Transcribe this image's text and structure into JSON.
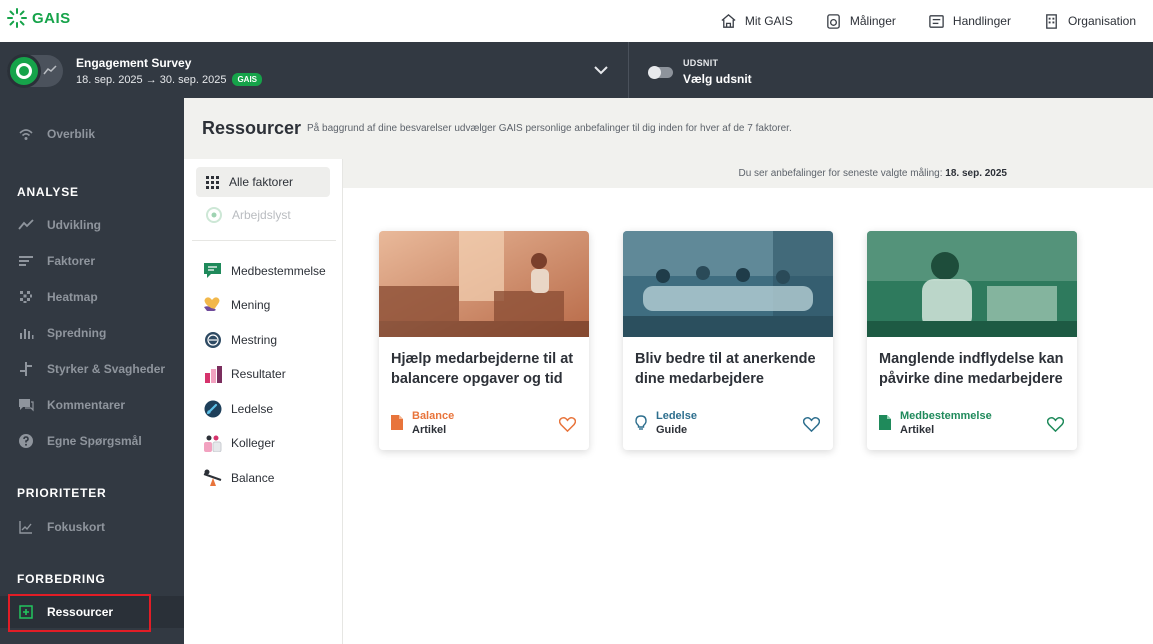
{
  "app": {
    "name": "GAIS"
  },
  "topnav": {
    "links": [
      {
        "label": "Mit GAIS",
        "icon": "home-icon"
      },
      {
        "label": "Målinger",
        "icon": "measure-icon"
      },
      {
        "label": "Handlinger",
        "icon": "actions-icon"
      },
      {
        "label": "Organisation",
        "icon": "building-icon"
      }
    ]
  },
  "survey": {
    "title": "Engagement Survey",
    "dates": "18. sep. 2025 → 30. sep. 2025",
    "tag": "GAIS",
    "udsnit_label": "UDSNIT",
    "udsnit_value": "Vælg udsnit"
  },
  "sidebar": {
    "overview": "Overblik",
    "analyse_title": "ANALYSE",
    "analyse": [
      {
        "label": "Udvikling",
        "icon": "trend-icon"
      },
      {
        "label": "Faktorer",
        "icon": "bars-icon"
      },
      {
        "label": "Heatmap",
        "icon": "heatmap-icon"
      },
      {
        "label": "Spredning",
        "icon": "spread-icon"
      },
      {
        "label": "Styrker & Svagheder",
        "icon": "strengths-icon"
      },
      {
        "label": "Kommentarer",
        "icon": "comments-icon"
      },
      {
        "label": "Egne Spørgsmål",
        "icon": "question-icon"
      }
    ],
    "prioriteter_title": "PRIORITETER",
    "fokuskort": "Fokuskort",
    "forbedring_title": "FORBEDRING",
    "ressourcer": "Ressourcer"
  },
  "header": {
    "title": "Ressourcer",
    "description": "På baggrund af dine besvarelser udvælger GAIS personlige anbefalinger til dig inden for hver af de 7 faktorer."
  },
  "factors": {
    "all_label": "Alle faktorer",
    "disabled_label": "Arbejdslyst",
    "items": [
      {
        "label": "Medbestemmelse",
        "icon": "chat-icon"
      },
      {
        "label": "Mening",
        "icon": "heart-hand-icon"
      },
      {
        "label": "Mestring",
        "icon": "gauge-icon"
      },
      {
        "label": "Resultater",
        "icon": "bar-chart-icon"
      },
      {
        "label": "Ledelse",
        "icon": "speedometer-icon"
      },
      {
        "label": "Kolleger",
        "icon": "people-icon"
      },
      {
        "label": "Balance",
        "icon": "seesaw-icon"
      }
    ]
  },
  "info": {
    "prefix": "Du ser anbefalinger for seneste valgte måling:",
    "date": "18. sep. 2025"
  },
  "cards": [
    {
      "title": "Hjælp medarbejderne til at balancere opgaver og tid",
      "category": "Balance",
      "type": "Artikel",
      "color": "#e8743b",
      "icon": "document-icon"
    },
    {
      "title": "Bliv bedre til at anerkende dine medarbejdere",
      "category": "Ledelse",
      "type": "Guide",
      "color": "#2e6f8e",
      "icon": "lightbulb-icon"
    },
    {
      "title": "Manglende indflydelse kan påvirke dine medarbejdere",
      "category": "Medbestemmelse",
      "type": "Artikel",
      "color": "#1f8a5b",
      "icon": "document-icon"
    }
  ]
}
